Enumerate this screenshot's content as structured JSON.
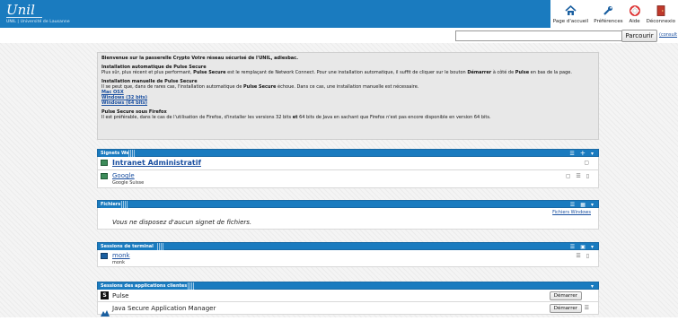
{
  "header": {
    "logo": "Unil",
    "logo_sub": "UNIL | Université de Lausanne",
    "toolbar": [
      {
        "name": "home-button",
        "icon": "home-icon",
        "label": "Page d'accueil"
      },
      {
        "name": "preferences-button",
        "icon": "wrench-icon",
        "label": "Préférences"
      },
      {
        "name": "help-button",
        "icon": "lifebuoy-icon",
        "label": "Aide"
      },
      {
        "name": "logout-button",
        "icon": "door-icon",
        "label": "Déconnexio"
      }
    ]
  },
  "search": {
    "value": "",
    "button": "Parcourir",
    "link": "(consult"
  },
  "info": {
    "welcome": "Bienvenue sur la passerelle Crypto Votre réseau sécurisé de l'UNIL, adiesbac.",
    "auto_title": "Installation automatique de Pulse Secure",
    "auto_text_1": "Plus sûr, plus récent et plus performant, ",
    "auto_text_bold": "Pulse Secure",
    "auto_text_2": " est le remplaçant de Network Connect. Pour une installation automatique, il suffit de cliquer sur le bouton ",
    "auto_text_bold2": "Démarrer",
    "auto_text_3": " à côté de ",
    "auto_text_bold3": "Pulse",
    "auto_text_4": " en bas de la page.",
    "manual_title": "Installation manuelle de Pulse Secure",
    "manual_text_1": "Il se peut que, dans de rares cas, l'installation automatique de ",
    "manual_text_bold": "Pulse Secure",
    "manual_text_2": " échoue. Dans ce cas, une installation manuelle est nécessaire.",
    "links": [
      "Mac OSX",
      "Windows (32 bits)",
      "Windows (64 bits)"
    ],
    "ff_title": "Pulse Secure sous Firefox",
    "ff_text_1": "Il est préférable, dans le cas de l'utilisation de Firefox, d'installer les versions 32 bits ",
    "ff_text_bold": "et",
    "ff_text_2": " 64 bits de Java en sachant que Firefox n'est pas encore disponible en version 64 bits."
  },
  "panels": {
    "web": {
      "title": "Signets Web",
      "items": [
        {
          "label": "Intranet Administratif",
          "sub": ""
        },
        {
          "label": "Google",
          "sub": "Google Suisse"
        }
      ]
    },
    "files": {
      "title": "Fichiers",
      "link": "Fichiers Windows",
      "empty": "Vous ne disposez d'aucun signet de fichiers."
    },
    "terminal": {
      "title": "Sessions de terminal",
      "items": [
        {
          "label": "monk",
          "sub": "monk"
        }
      ]
    },
    "clients": {
      "title": "Sessions des applications clientes",
      "items": [
        {
          "label": "Pulse",
          "button": "Démarrer"
        },
        {
          "label": "Java Secure Application Manager",
          "button": "Démarrer"
        }
      ]
    }
  },
  "colors": {
    "brand": "#1a7bbf",
    "link": "#1a4fa0"
  }
}
